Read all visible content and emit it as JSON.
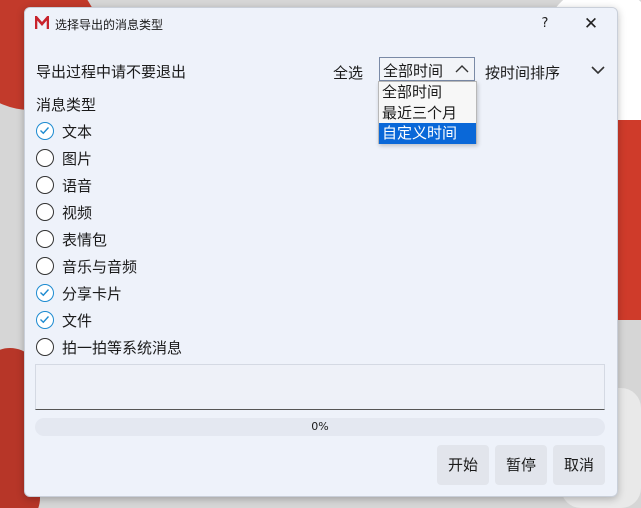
{
  "window": {
    "title": "选择导出的消息类型",
    "help": "?",
    "close": "✕",
    "app_icon": "M"
  },
  "toolbar": {
    "notice": "导出过程中请不要退出",
    "select_all": "全选",
    "time_range_value": "全部时间",
    "sort_label": "按时间排序"
  },
  "time_range_options": [
    "全部时间",
    "最近三个月",
    "自定义时间"
  ],
  "time_range_highlighted": "自定义时间",
  "message_types": {
    "label": "消息类型",
    "items": [
      {
        "label": "文本",
        "checked": true
      },
      {
        "label": "图片",
        "checked": false
      },
      {
        "label": "语音",
        "checked": false
      },
      {
        "label": "视频",
        "checked": false
      },
      {
        "label": "表情包",
        "checked": false
      },
      {
        "label": "音乐与音频",
        "checked": false
      },
      {
        "label": "分享卡片",
        "checked": true
      },
      {
        "label": "文件",
        "checked": true
      },
      {
        "label": "拍一拍等系统消息",
        "checked": false
      }
    ]
  },
  "progress": {
    "text": "0%",
    "value": 0
  },
  "buttons": {
    "start": "开始",
    "pause": "暂停",
    "cancel": "取消"
  },
  "colors": {
    "accent": "#1d8bd1",
    "highlight": "#0a68d8",
    "app_icon": "#c8232c"
  }
}
